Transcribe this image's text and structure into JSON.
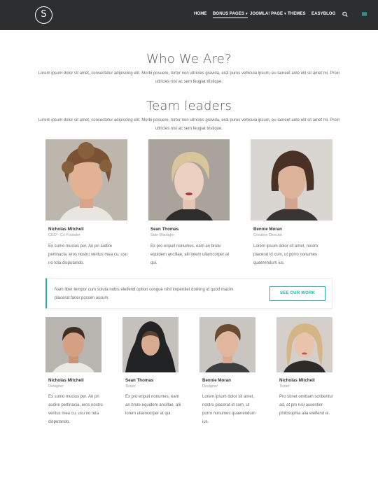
{
  "header": {
    "logo_letter": "S",
    "nav": [
      {
        "label": "HOME"
      },
      {
        "label": "BONUS PAGES",
        "caret": "▾"
      },
      {
        "label": "JOOMLA! PAGE",
        "caret": "▾"
      },
      {
        "label": "THEMES"
      },
      {
        "label": "EASYBLOG"
      }
    ],
    "icons": {
      "search": "search-icon",
      "menu": "hamburger-menu-icon"
    },
    "accent_color": "#1fb5a6"
  },
  "who": {
    "title": "Who We Are?",
    "text": "Lorem ipsum dolor sit amet, consectetur adipiscing elit. Morbi posuere, tortor non ultricies gravida, erat purus vehicula ipsum, eu laoreet ante elit sit amet mi. Proin ultricies nisi ac sem feugiat tristique."
  },
  "leaders": {
    "title": "Team leaders",
    "text": "Lorem ipsum dolor sit amet, consectetur adipiscing elit. Morbi posuere, tortor non ultricies gravida, erat purus vehicula ipsum, eu laoreet ante elit sit amet mi. Proin ultricies nisi ac sem feugiat tristique.",
    "members": [
      {
        "name": "Nicholas Mitchell",
        "role": "CEO - Co Founder",
        "bio": "Ex sumo mucius per. An pri audire pertinacia, eros nostro veritus mea cu, usu no tota disputando."
      },
      {
        "name": "Sean Thomas",
        "role": "Sale Manager",
        "bio": "Ex pro eripuit nonumes, eam an brute equidem ancillae, alii lorem ullamcorper at qui."
      },
      {
        "name": "Bennie Moran",
        "role": "Creative Director",
        "bio": "Lorem ipsum dolor sit amet, nostro placerat id cum, ut porro nonumes quaerendum ius."
      }
    ]
  },
  "cta": {
    "text": "Nam liber tempor cum soluta nobis eleifend option congue nihil imperdiet doming id quod mazim placerat facer possim assum.",
    "button": "SEE OUR WORK"
  },
  "team": {
    "members": [
      {
        "name": "Nicholas Mitchell",
        "role": "Designer",
        "bio": "Ex sumo mucius per. An pri audire pertinacia, eros nostro veritus mea cu, usu no tota disputando."
      },
      {
        "name": "Sean Thomas",
        "role": "Tester",
        "bio": "Ex pro eripuit nonumes, eam an brute equidem ancillae, alii lorem ullamcorper at qui."
      },
      {
        "name": "Bennie Moran",
        "role": "Designer",
        "bio": "Lorem ipsum dolor sit amet, nostro placerat id cum, ut porro nonumes quaerendum ius."
      },
      {
        "name": "Nicholas Mitchell",
        "role": "Tester",
        "bio": "Pro sonet omittam scribentur ad, at pro nisl assentior philosophia alia eleifend ei."
      }
    ]
  }
}
